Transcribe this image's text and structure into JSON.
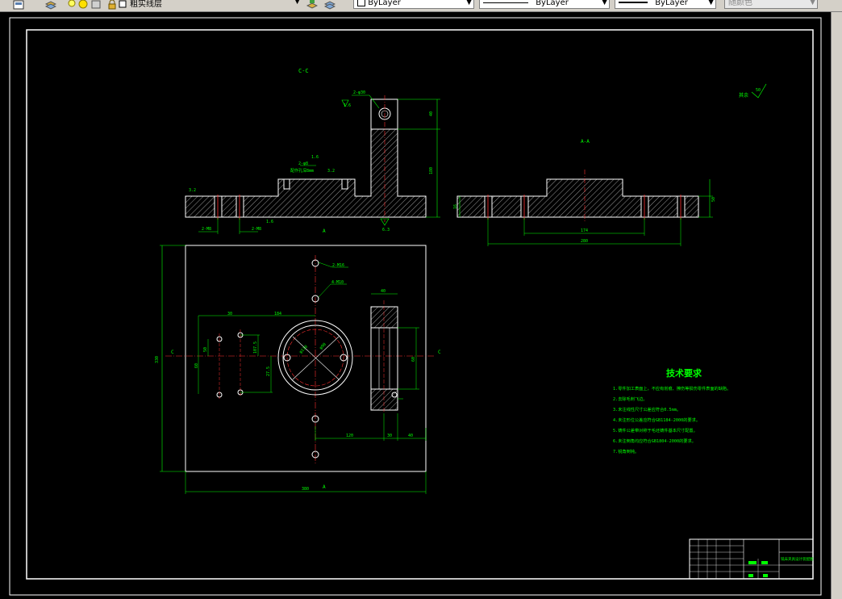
{
  "toolbar": {
    "layer_name": "粗实线层",
    "color_label": "ByLayer",
    "linetype_label": "ByLayer",
    "lineweight_label": "ByLayer",
    "plotstyle_label": "随颜色"
  },
  "drawing": {
    "section_label_cc": "C-C",
    "section_label_aa": "A-A",
    "marker_a": "A",
    "marker_c": "C",
    "rest_roughness": "其余",
    "rest_roughness_value": "50",
    "dims": {
      "hole_top": "2-φ30",
      "h_40": "40",
      "h_180": "180",
      "ra_16": "1.6",
      "ra_32": "3.2",
      "ra_63": "6.3",
      "ra_16b": "1.6",
      "slot_note": "2-φ8",
      "slot_note2": "配作孔深8mm",
      "bot_2m8": "2-M8",
      "bot_2m8b": "2-M8",
      "aa_174": "174",
      "aa_280": "280",
      "aa_16": "16",
      "aa_50": "50",
      "plan_330": "330",
      "plan_380": "380",
      "plan_30": "30",
      "plan_184": "184",
      "plan_50": "50",
      "plan_60": "60",
      "plan_90": "90",
      "plan_120": "120",
      "plan_1075": "107.5",
      "plan_275": "27.5",
      "circle_a": "φ110",
      "circle_b": "φ90",
      "hole_note1": "2-M16",
      "hole_note2": "4-M10",
      "side_40": "40",
      "side_60": "60",
      "bot_120": "120",
      "bot_30": "30",
      "bot_40": "40"
    }
  },
  "tech": {
    "title": "技术要求",
    "items": [
      "1.零件加工表面上，不应有划痕、擦伤等损伤零件表面的缺陷。",
      "2.去除毛刺飞边。",
      "3.未注线性尺寸公差应符合0.5mm。",
      "4.未注形位公差应符合GB1184-2000的要求。",
      "5.铸件公差带对称于毛坯铸件基本尺寸配置。",
      "6.未注倒角均应符合GB1804-2000的要求。",
      "7.锐角倒钝。"
    ]
  },
  "title_block": {
    "drawing_name": "铣床夹具设计装配图"
  }
}
